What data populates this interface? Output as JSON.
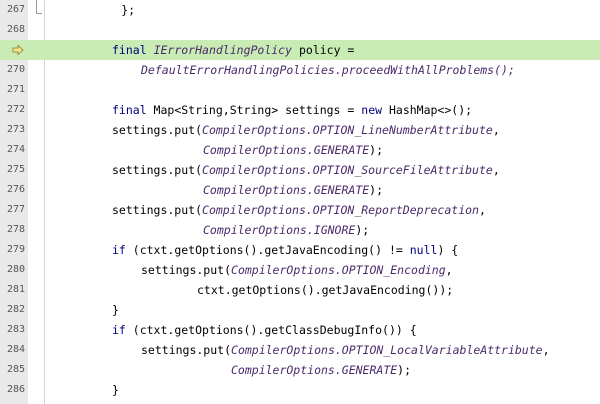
{
  "editor": {
    "line_numbers": [
      "267",
      "268",
      "",
      "270",
      "271",
      "272",
      "273",
      "274",
      "275",
      "276",
      "277",
      "278",
      "279",
      "280",
      "281",
      "282",
      "283",
      "284",
      "285",
      "286"
    ],
    "current_line_indicator": "arrow-right-icon",
    "highlight_color": "#c8ecb4",
    "lines": {
      "l267": "          };",
      "l269_a": "final",
      "l269_b": "IErrorHandlingPolicy",
      "l269_c": " policy =",
      "l270": "DefaultErrorHandlingPolicies.proceedWithAllProblems();",
      "l272_a": "final",
      "l272_b": " Map<String,String> settings = ",
      "l272_c": "new",
      "l272_d": " HashMap<>();",
      "l273_a": "settings.put(",
      "l273_b": "CompilerOptions.",
      "l273_c": "OPTION_LineNumberAttribute",
      "l273_d": ",",
      "l274_a": "CompilerOptions.",
      "l274_b": "GENERATE",
      "l274_c": ");",
      "l275_a": "settings.put(",
      "l275_b": "CompilerOptions.",
      "l275_c": "OPTION_SourceFileAttribute",
      "l275_d": ",",
      "l276_a": "CompilerOptions.",
      "l276_b": "GENERATE",
      "l276_c": ");",
      "l277_a": "settings.put(",
      "l277_b": "CompilerOptions.",
      "l277_c": "OPTION_ReportDeprecation",
      "l277_d": ",",
      "l278_a": "CompilerOptions.",
      "l278_b": "IGNORE",
      "l278_c": ");",
      "l279_a": "if",
      "l279_b": " (ctxt.getOptions().getJavaEncoding() != ",
      "l279_c": "null",
      "l279_d": ") {",
      "l280_a": "settings.put(",
      "l280_b": "CompilerOptions.",
      "l280_c": "OPTION_Encoding",
      "l280_d": ",",
      "l281": "ctxt.getOptions().getJavaEncoding());",
      "l282": "}",
      "l283_a": "if",
      "l283_b": " (ctxt.getOptions().getClassDebugInfo()) {",
      "l284_a": "settings.put(",
      "l284_b": "CompilerOptions.",
      "l284_c": "OPTION_LocalVariableAttribute",
      "l284_d": ",",
      "l285_a": "CompilerOptions.",
      "l285_b": "GENERATE",
      "l285_c": ");",
      "l286": "}"
    }
  }
}
